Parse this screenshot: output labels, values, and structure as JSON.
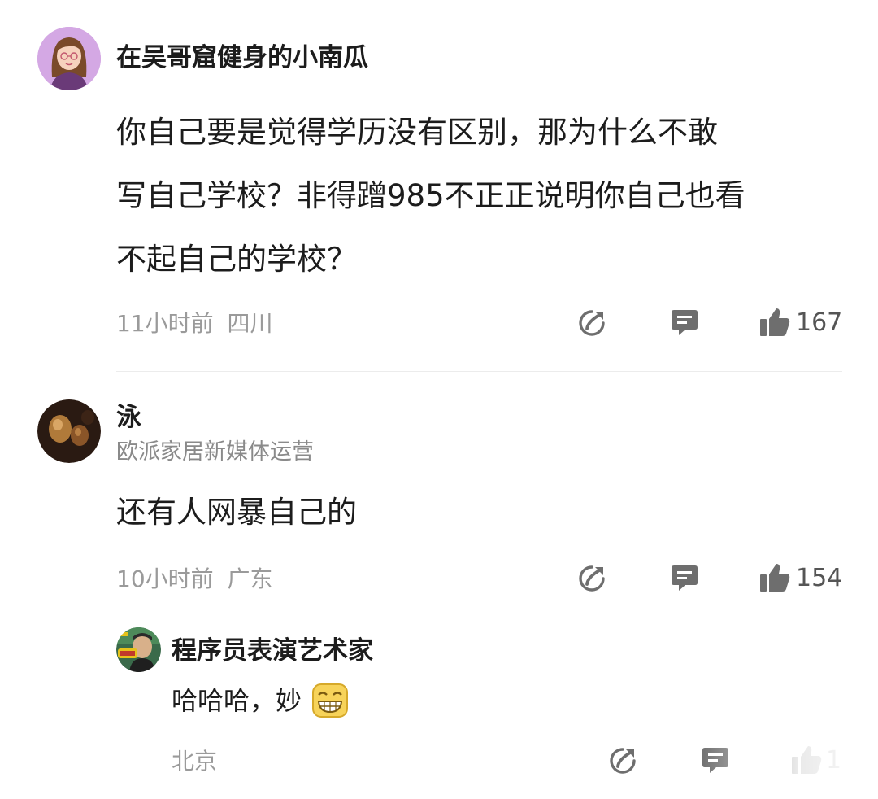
{
  "comments": [
    {
      "username": "在吴哥窟健身的小南瓜",
      "avatar_icon": "cartoon-girl-avatar",
      "text_lines": [
        "你自己要是觉得学历没有区别，那为什么不敢",
        "写自己学校？非得蹭985不正正说明你自己也看",
        "不起自己的学校？"
      ],
      "time": "11小时前",
      "location": "四川",
      "likes": "167"
    },
    {
      "username": "泳",
      "subtitle": "欧派家居新媒体运营",
      "avatar_icon": "eggs-photo-avatar",
      "text": "还有人网暴自己的",
      "time": "10小时前",
      "location": "广东",
      "likes": "154"
    }
  ],
  "reply": {
    "username": "程序员表演艺术家",
    "avatar_icon": "person-photo-avatar",
    "text": "哈哈哈，妙",
    "emoji_icon": "grin-emoji-icon",
    "location": "北京",
    "likes": "1"
  },
  "icons": {
    "share": "share-icon",
    "reply": "reply-icon",
    "like": "thumbs-up-icon"
  },
  "colors": {
    "icon_gray": "#6e6e6e",
    "meta_gray": "#9a9a9a",
    "avatar1_bg": "#cfa3e0"
  }
}
